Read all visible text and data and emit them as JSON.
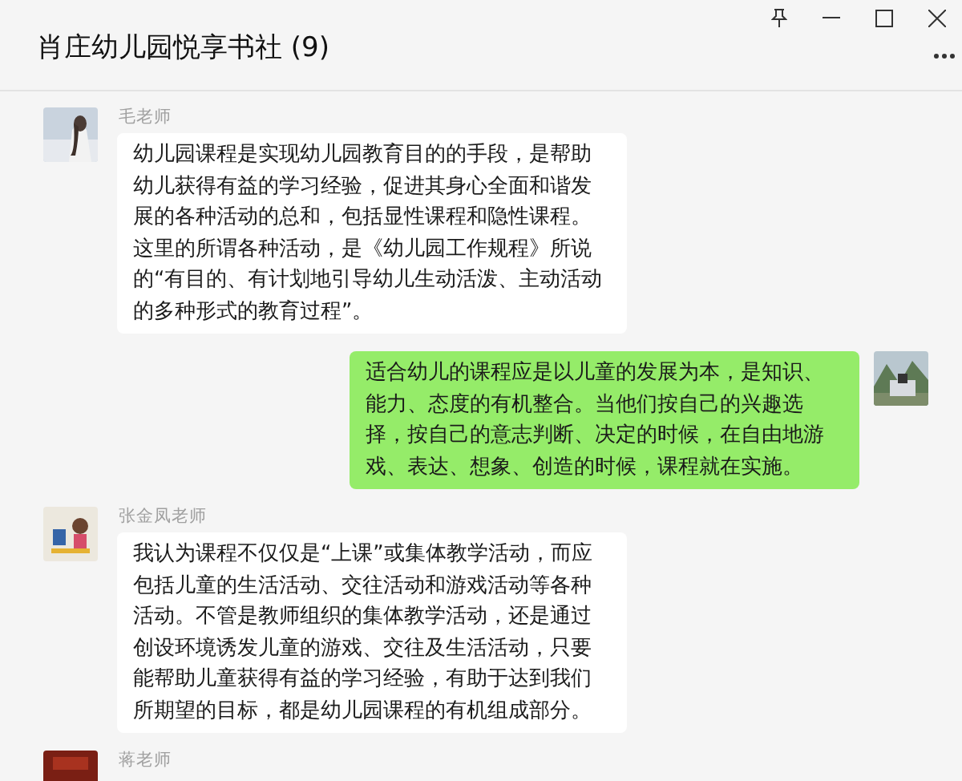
{
  "window": {
    "title": "肖庄幼儿园悦享书社 (9)"
  },
  "messages": [
    {
      "sender": "毛老师",
      "outgoing": false,
      "text": "幼儿园课程是实现幼儿园教育目的的手段，是帮助幼儿获得有益的学习经验，促进其身心全面和谐发展的各种活动的总和，包括显性课程和隐性课程。这里的所谓各种活动，是《幼儿园工作规程》所说的“有目的、有计划地引导幼儿生动活泼、主动活动的多种形式的教育过程”。"
    },
    {
      "outgoing": true,
      "text": "适合幼儿的课程应是以儿童的发展为本，是知识、能力、态度的有机整合。当他们按自己的兴趣选择，按自己的意志判断、决定的时候，在自由地游戏、表达、想象、创造的时候，课程就在实施。"
    },
    {
      "sender": "张金凤老师",
      "outgoing": false,
      "text": "我认为课程不仅仅是“上课”或集体教学活动，而应包括儿童的生活活动、交往活动和游戏活动等各种活动。不管是教师组织的集体教学活动，还是通过创设环境诱发儿童的游戏、交往及生活活动，只要能帮助儿童获得有益的学习经验，有助于达到我们所期望的目标，都是幼儿园课程的有机组成部分。"
    },
    {
      "sender": "蒋老师",
      "outgoing": false
    }
  ]
}
